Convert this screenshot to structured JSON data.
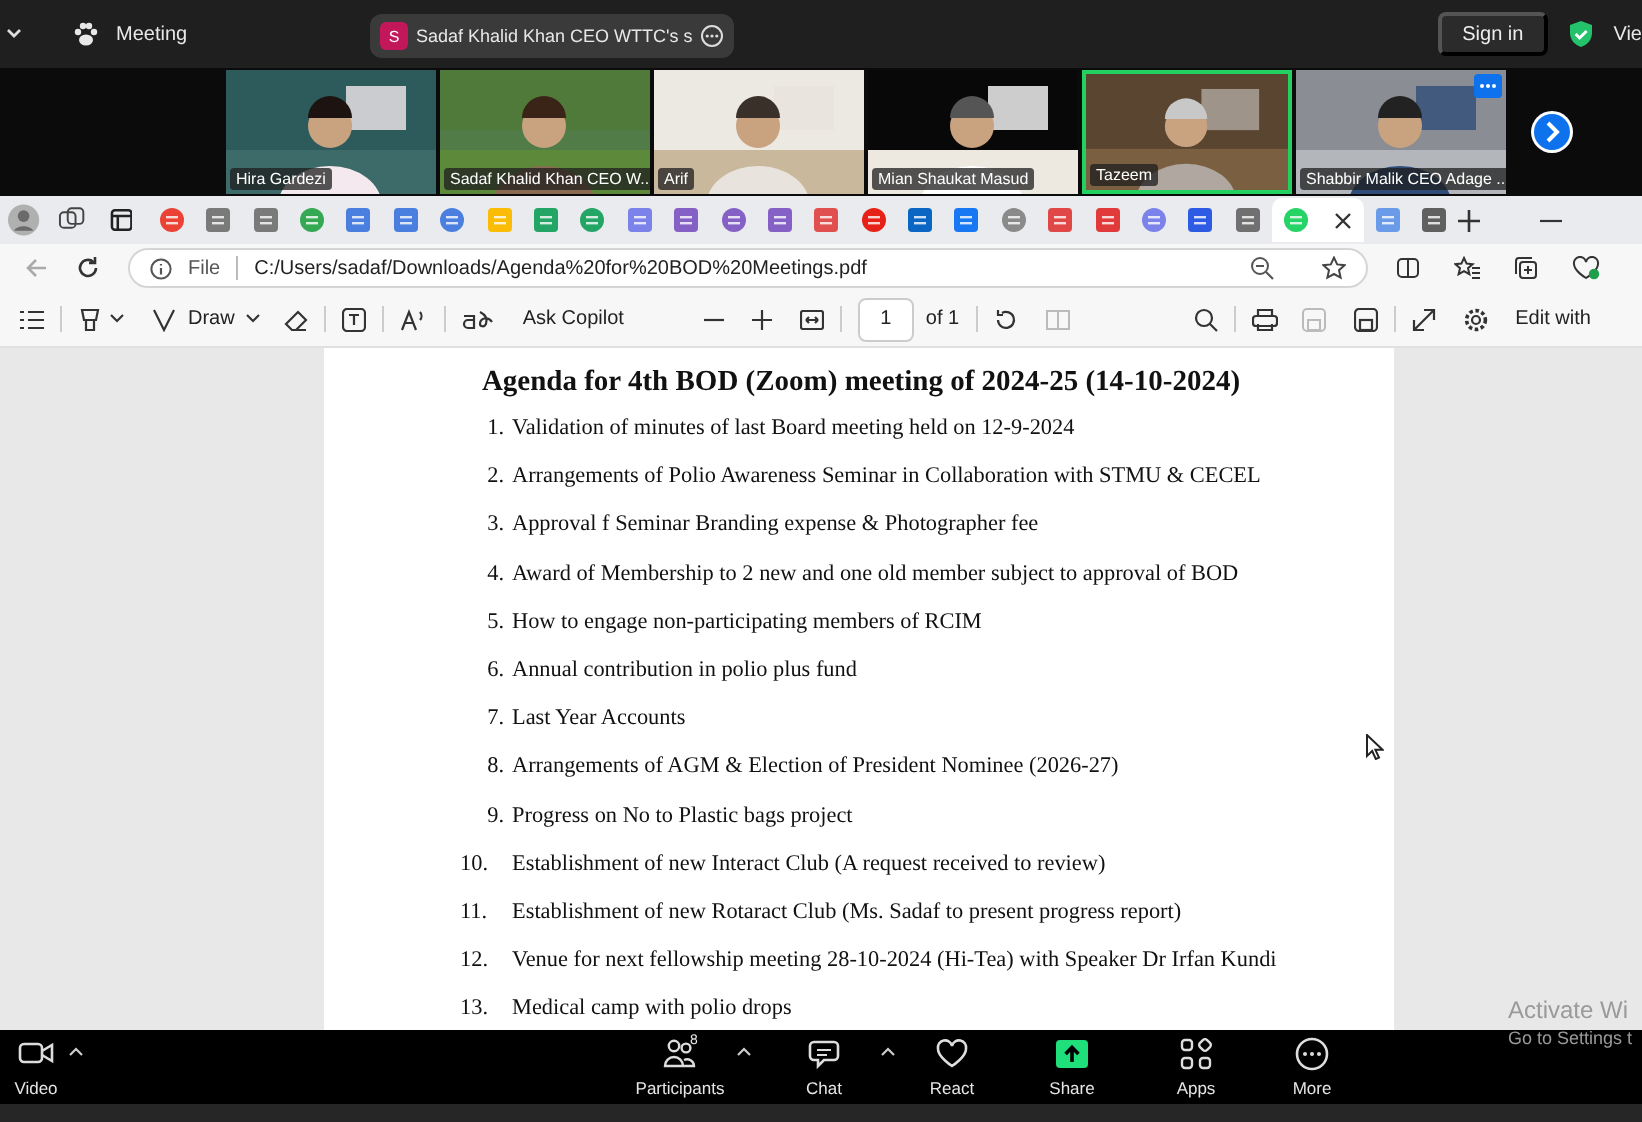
{
  "top_bar": {
    "meeting_label": "Meeting",
    "speaker": {
      "initial": "S",
      "name": "Sadaf Khalid Khan CEO WTTC's s"
    },
    "sign_in": "Sign in",
    "view": "Vie"
  },
  "participants": [
    {
      "name": "Hira Gardezi",
      "speaking": false,
      "kind": "picture"
    },
    {
      "name": "Sadaf Khalid Khan CEO W...",
      "speaking": false,
      "kind": "picture"
    },
    {
      "name": "Arif",
      "speaking": false,
      "kind": "picture"
    },
    {
      "name": "Mian Shaukat Masud",
      "speaking": false,
      "kind": "picture"
    },
    {
      "name": "Tazeem",
      "speaking": true,
      "kind": "picture"
    },
    {
      "name": "Shabbir Malik CEO Adage ...",
      "speaking": false,
      "kind": "picture"
    }
  ],
  "browser_tabs": [
    {
      "color": "#ea4335",
      "selected": false
    },
    {
      "color": "#7a7a7a",
      "selected": false
    },
    {
      "color": "#7a7a7a",
      "selected": false
    },
    {
      "color": "#34a853",
      "selected": false
    },
    {
      "color": "#4a7fe0",
      "selected": false
    },
    {
      "color": "#4a7fe0",
      "selected": false
    },
    {
      "color": "#4a7fe0",
      "selected": false
    },
    {
      "color": "#fbbc05",
      "selected": false
    },
    {
      "color": "#23a566",
      "selected": false
    },
    {
      "color": "#23a566",
      "selected": false
    },
    {
      "color": "#7b83eb",
      "selected": false
    },
    {
      "color": "#8661c5",
      "selected": false
    },
    {
      "color": "#8661c5",
      "selected": false
    },
    {
      "color": "#8661c5",
      "selected": false
    },
    {
      "color": "#e05050",
      "selected": false
    },
    {
      "color": "#e62117",
      "selected": false
    },
    {
      "color": "#0a66c2",
      "selected": false
    },
    {
      "color": "#1877f2",
      "selected": false
    },
    {
      "color": "#8a8a8a",
      "selected": false
    },
    {
      "color": "#e04848",
      "selected": false
    },
    {
      "color": "#e03a3a",
      "selected": false
    },
    {
      "color": "#7b83eb",
      "selected": false
    },
    {
      "color": "#2d5be3",
      "selected": false
    },
    {
      "color": "#707070",
      "selected": false
    },
    {
      "color": "#25d366",
      "selected": true
    },
    {
      "color": "#6a9be8",
      "selected": false
    },
    {
      "color": "#606060",
      "selected": false
    }
  ],
  "address_bar": {
    "scheme_label": "File",
    "url": "C:/Users/sadaf/Downloads/Agenda%20for%20BOD%20Meetings.pdf"
  },
  "pdf_toolbar": {
    "draw": "Draw",
    "ask_copilot": "Ask Copilot",
    "page_number": "1",
    "page_count": "of 1",
    "edit": "Edit with"
  },
  "document": {
    "title": "Agenda for 4th BOD (Zoom) meeting of 2024-25 (14-10-2024)",
    "items": [
      {
        "number": "1.",
        "text": "Validation of minutes of last Board meeting held on 12-9-2024"
      },
      {
        "number": "2.",
        "text": "Arrangements of Polio Awareness Seminar in Collaboration with STMU & CECEL"
      },
      {
        "number": "3.",
        "text": "Approval f Seminar Branding expense & Photographer fee"
      },
      {
        "number": "4.",
        "text": "Award of Membership to 2 new and one old member subject to approval of BOD"
      },
      {
        "number": "5.",
        "text": "How to engage non-participating members of RCIM"
      },
      {
        "number": "6.",
        "text": "Annual contribution in polio plus fund"
      },
      {
        "number": "7.",
        "text": "Last Year Accounts"
      },
      {
        "number": "8.",
        "text": "Arrangements of AGM & Election of President Nominee (2026-27)"
      },
      {
        "number": "9.",
        "text": "Progress on No to Plastic bags project"
      },
      {
        "number": "10.",
        "text": "Establishment of new Interact Club (A request received to review)"
      },
      {
        "number": "11.",
        "text": "Establishment of new Rotaract Club (Ms. Sadaf to present progress report)"
      },
      {
        "number": "12.",
        "text": "Venue for next fellowship meeting 28-10-2024 (Hi-Tea) with Speaker Dr Irfan Kundi"
      },
      {
        "number": "13.",
        "text": "Medical camp with polio drops"
      }
    ]
  },
  "os_notice": {
    "line_1": "Activate Wi",
    "line_2": "Go to Settings t"
  },
  "meeting_controls": [
    {
      "kind": "video",
      "label": "Video",
      "caret": true
    },
    {
      "kind": "participants",
      "label": "Participants",
      "count": "8",
      "caret": true
    },
    {
      "kind": "chat",
      "label": "Chat",
      "caret": true
    },
    {
      "kind": "react",
      "label": "React",
      "caret": false
    },
    {
      "kind": "share",
      "label": "Share",
      "caret": false
    },
    {
      "kind": "apps",
      "label": "Apps",
      "caret": false
    },
    {
      "kind": "more",
      "label": "More",
      "caret": false
    }
  ]
}
